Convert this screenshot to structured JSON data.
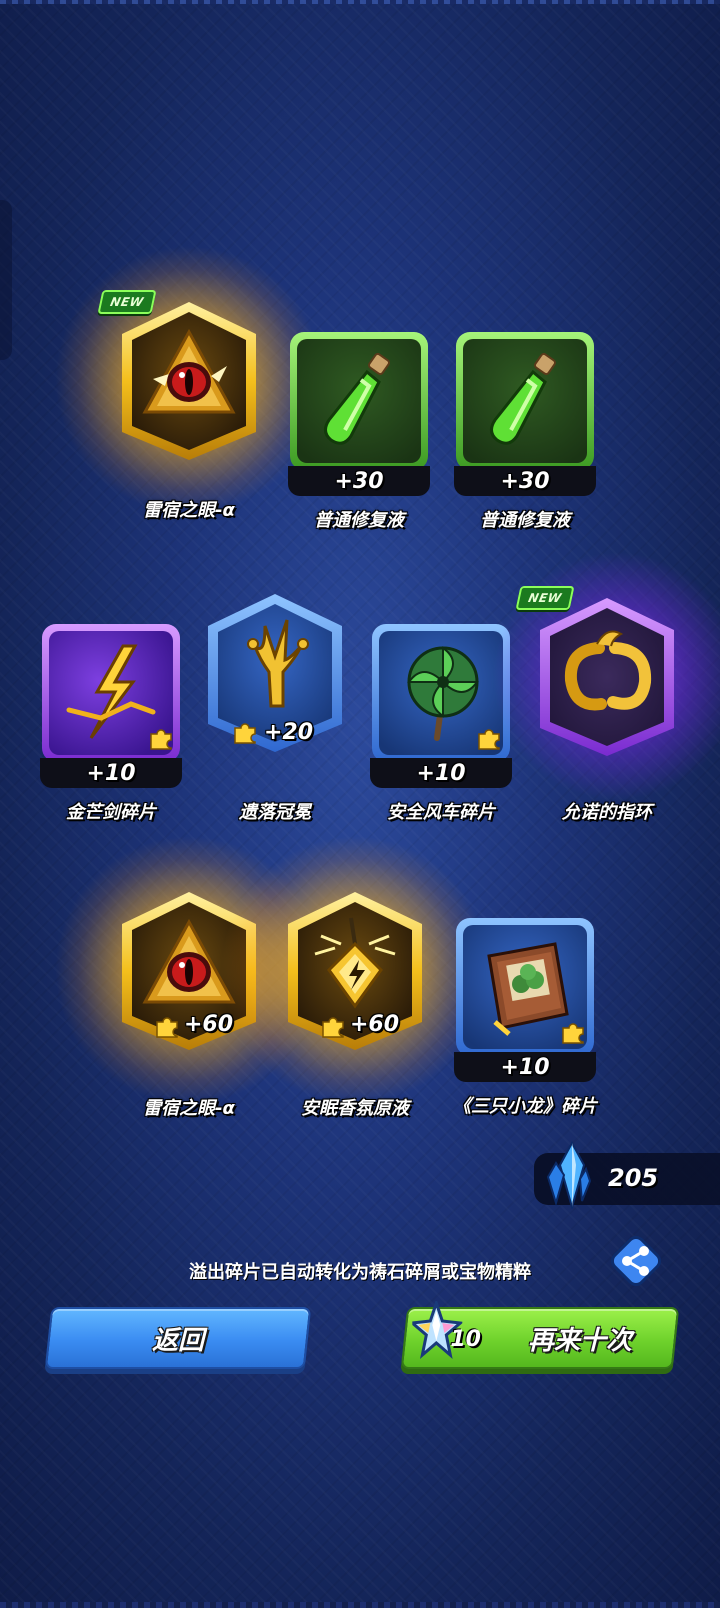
{
  "results": [
    {
      "name": "雷宿之眼-α",
      "count": "",
      "rarity": "gold",
      "is_new": true,
      "new_label": "NEW",
      "icon": "red-eye-triangle-icon",
      "is_fragment": false
    },
    {
      "name": "普通修复液",
      "count": "+30",
      "rarity": "green",
      "is_new": false,
      "icon": "green-potion-icon",
      "is_fragment": false
    },
    {
      "name": "普通修复液",
      "count": "+30",
      "rarity": "green",
      "is_new": false,
      "icon": "green-potion-icon",
      "is_fragment": false
    },
    {
      "name": "金芒剑碎片",
      "count": "+10",
      "rarity": "purple",
      "is_new": false,
      "icon": "lightning-sword-icon",
      "is_fragment": true
    },
    {
      "name": "遗落冠冕",
      "count": "+20",
      "rarity": "blue",
      "is_new": false,
      "icon": "golden-crown-icon",
      "is_fragment": true
    },
    {
      "name": "安全风车碎片",
      "count": "+10",
      "rarity": "blue",
      "is_new": false,
      "icon": "pinwheel-icon",
      "is_fragment": true
    },
    {
      "name": "允诺的指环",
      "count": "",
      "rarity": "purple",
      "is_new": true,
      "new_label": "NEW",
      "icon": "golden-ring-icon",
      "is_fragment": false
    },
    {
      "name": "雷宿之眼-α",
      "count": "+60",
      "rarity": "gold",
      "is_new": false,
      "icon": "red-eye-triangle-icon",
      "is_fragment": true
    },
    {
      "name": "安眠香氛原液",
      "count": "+60",
      "rarity": "gold",
      "is_new": false,
      "icon": "perfume-vial-icon",
      "is_fragment": true
    },
    {
      "name": "《三只小龙》碎片",
      "count": "+10",
      "rarity": "blue",
      "is_new": false,
      "icon": "dragon-book-icon",
      "is_fragment": true
    }
  ],
  "currency": {
    "amount": "205",
    "icon": "blue-crystal-icon"
  },
  "notice": "溢出碎片已自动转化为祷石碎屑或宝物精粹",
  "buttons": {
    "back_label": "返回",
    "again_label": "再来十次",
    "again_cost": "10",
    "again_cost_icon": "star-crystal-icon"
  },
  "colors": {
    "gold": "#f6c21a",
    "purple": "#9b3df0",
    "green": "#58c53a",
    "blue": "#3f7fe0",
    "back_button": "#3a8cf2",
    "again_button": "#6fd22c"
  }
}
